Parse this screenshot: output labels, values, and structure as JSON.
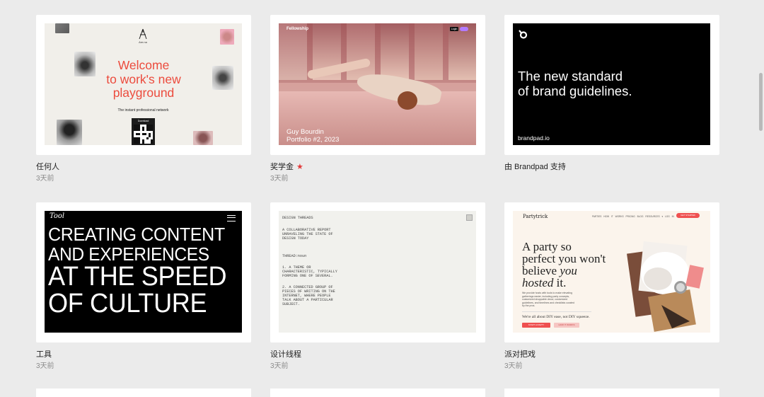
{
  "cards": [
    {
      "title": "任何人",
      "subtitle": "3天前",
      "preview": {
        "brand": "Are.na",
        "headline_lines": [
          "Welcome",
          "to work's new",
          "playground"
        ],
        "tagline": "The instant professional network",
        "qr_label": "Download"
      }
    },
    {
      "title": "奖学金",
      "subtitle": "3天前",
      "star": "★",
      "preview": {
        "brand": "Fellowship",
        "pill": "Login",
        "caption_line1": "Guy Bourdin",
        "caption_line2": "Portfolio #2, 2023"
      }
    },
    {
      "title": "由 Brandpad 支持",
      "subtitle": "",
      "preview": {
        "headline_lines": [
          "The new standard",
          "of brand guidelines."
        ],
        "url": "brandpad.io"
      }
    },
    {
      "title": "工具",
      "subtitle": "3天前",
      "preview": {
        "logo": "Tool",
        "lines": [
          "CREATING CONTENT",
          "AND EXPERIENCES",
          "AT THE SPEED",
          "OF CULTURE"
        ]
      }
    },
    {
      "title": "设计线程",
      "subtitle": "3天前",
      "preview": {
        "header": "DESIGN THREADS",
        "intro": "A COLLABORATIVE REPORT\nUNRAVELING THE STATE OF\nDESIGN TODAY",
        "label": "THREAD:noun",
        "def1": "1. A THEME OR\nCHARACTERISTIC, TYPICALLY\nFORMING ONE OF SEVERAL.",
        "def2": "2. A CONNECTED GROUP OF\nPIECES OF WRITING ON THE\nINTERNET, WHERE PEOPLE\nTALK ABOUT A PARTICULAR\nSUBJECT."
      }
    },
    {
      "title": "派对把戏",
      "subtitle": "3天前",
      "preview": {
        "logo": "Partytrick",
        "nav": "PARTIES HOW IT WORKS PRICING BLOG RESOURCES ▾ LOG IN",
        "nav_button": "GET STARTED",
        "headline_line1": "A party so",
        "headline_line2": "perfect you won't",
        "headline_line3a": "believe ",
        "headline_line3b": "you",
        "headline_line4a": "hosted",
        "headline_line4b": " it.",
        "body": "We provide hosts with tools to make elevating gatherings easier, including party concepts, customized shoppable decor, customized guidelines, and timelines and checklists curated by the pros.",
        "sub": "We're all about DIY ease, not DIY squeeze.",
        "btn1": "START A PARTY",
        "btn2": "HOW IT WORKS"
      }
    }
  ],
  "colors": {
    "background": "#ebebeb",
    "card": "#ffffff",
    "arena_red": "#ec4b3d",
    "star_red": "#e23b3b",
    "partytrick_red": "#ef5050"
  }
}
